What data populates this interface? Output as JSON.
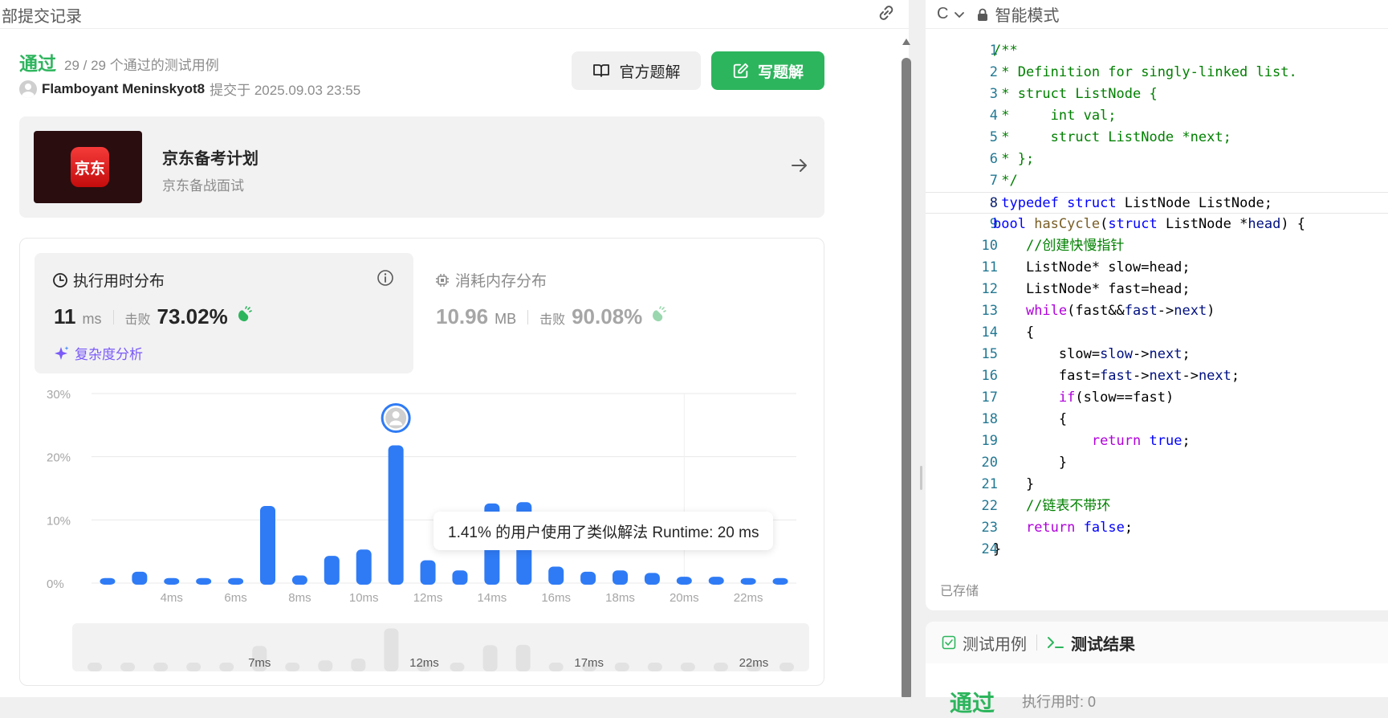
{
  "header": {
    "title": "部提交记录"
  },
  "submission": {
    "status": "通过",
    "testcases": "29 / 29 个通过的测试用例",
    "author": "Flamboyant Meninskyot8",
    "submitted_at": "提交于 2025.09.03 23:55"
  },
  "buttons": {
    "official_solution": "官方题解",
    "write_solution": "写题解"
  },
  "promo": {
    "logo_text": "京东",
    "title": "京东备考计划",
    "subtitle": "京东备战面试"
  },
  "runtime": {
    "title": "执行用时分布",
    "value": "11",
    "unit": "ms",
    "beat_label": "击败",
    "beat": "73.02%",
    "complexity": "复杂度分析"
  },
  "memory": {
    "title": "消耗内存分布",
    "value": "10.96",
    "unit": "MB",
    "beat_label": "击败",
    "beat": "90.08%"
  },
  "chart_data": {
    "type": "bar",
    "ytick_labels": [
      "30%",
      "20%",
      "10%",
      "0%"
    ],
    "ylim": [
      0,
      30
    ],
    "x": [
      2,
      3,
      4,
      5,
      6,
      7,
      8,
      9,
      10,
      11,
      12,
      13,
      14,
      15,
      16,
      17,
      18,
      19,
      20,
      21,
      22,
      23
    ],
    "values": [
      0.8,
      1.8,
      0.8,
      0.8,
      0.8,
      12.2,
      1.2,
      4.3,
      5.3,
      21.8,
      3.6,
      2.0,
      12.6,
      12.8,
      2.6,
      1.8,
      2.0,
      1.6,
      1.0,
      1.0,
      0.8,
      0.8
    ],
    "xtick_labels": [
      {
        "x": 4,
        "label": "4ms"
      },
      {
        "x": 6,
        "label": "6ms"
      },
      {
        "x": 8,
        "label": "8ms"
      },
      {
        "x": 10,
        "label": "10ms"
      },
      {
        "x": 12,
        "label": "12ms"
      },
      {
        "x": 14,
        "label": "14ms"
      },
      {
        "x": 16,
        "label": "16ms"
      },
      {
        "x": 18,
        "label": "18ms"
      },
      {
        "x": 20,
        "label": "20ms"
      },
      {
        "x": 22,
        "label": "22ms"
      }
    ],
    "highlight_x": 11,
    "bar_color": "#2f7bf5",
    "grid": true,
    "overview_labels": [
      {
        "x": 7,
        "label": "7ms"
      },
      {
        "x": 12,
        "label": "12ms"
      },
      {
        "x": 17,
        "label": "17ms"
      },
      {
        "x": 22,
        "label": "22ms"
      }
    ]
  },
  "tooltip": {
    "text": "1.41% 的用户使用了类似解法 Runtime: 20 ms"
  },
  "editor": {
    "language": "C",
    "mode": "智能模式",
    "saved": "已存储",
    "active_line": 8,
    "lines": [
      [
        [
          "c-com",
          "/**"
        ]
      ],
      [
        [
          "c-com",
          " * Definition for singly-linked list."
        ]
      ],
      [
        [
          "c-com",
          " * struct ListNode {"
        ]
      ],
      [
        [
          "c-com",
          " *     int val;"
        ]
      ],
      [
        [
          "c-com",
          " *     struct ListNode *next;"
        ]
      ],
      [
        [
          "c-com",
          " * };"
        ]
      ],
      [
        [
          "c-com",
          " */"
        ]
      ],
      [
        [
          "c-kw",
          " typedef"
        ],
        [
          "c-txt",
          " "
        ],
        [
          "c-kw",
          "struct"
        ],
        [
          "c-txt",
          " ListNode ListNode;"
        ]
      ],
      [
        [
          "c-kw",
          "bool"
        ],
        [
          "c-txt",
          " "
        ],
        [
          "c-fn",
          "hasCycle"
        ],
        [
          "c-txt",
          "("
        ],
        [
          "c-kw",
          "struct"
        ],
        [
          "c-txt",
          " ListNode *"
        ],
        [
          "c-var",
          "head"
        ],
        [
          "c-txt",
          ") {"
        ]
      ],
      [
        [
          "c-txt",
          "    "
        ],
        [
          "c-com",
          "//创建快慢指针"
        ]
      ],
      [
        [
          "c-txt",
          "    ListNode* slow=head;"
        ]
      ],
      [
        [
          "c-txt",
          "    ListNode* fast=head;"
        ]
      ],
      [
        [
          "c-txt",
          "    "
        ],
        [
          "c-ctl",
          "while"
        ],
        [
          "c-txt",
          "(fast&&"
        ],
        [
          "c-var",
          "fast"
        ],
        [
          "c-txt",
          "->"
        ],
        [
          "c-var",
          "next"
        ],
        [
          "c-txt",
          ")"
        ]
      ],
      [
        [
          "c-txt",
          "    {"
        ]
      ],
      [
        [
          "c-txt",
          "        slow="
        ],
        [
          "c-var",
          "slow"
        ],
        [
          "c-txt",
          "->"
        ],
        [
          "c-var",
          "next"
        ],
        [
          "c-txt",
          ";"
        ]
      ],
      [
        [
          "c-txt",
          "        fast="
        ],
        [
          "c-var",
          "fast"
        ],
        [
          "c-txt",
          "->"
        ],
        [
          "c-var",
          "next"
        ],
        [
          "c-txt",
          "->"
        ],
        [
          "c-var",
          "next"
        ],
        [
          "c-txt",
          ";"
        ]
      ],
      [
        [
          "c-txt",
          "        "
        ],
        [
          "c-ctl",
          "if"
        ],
        [
          "c-txt",
          "(slow==fast)"
        ]
      ],
      [
        [
          "c-txt",
          "        {"
        ]
      ],
      [
        [
          "c-txt",
          "            "
        ],
        [
          "c-ctl",
          "return"
        ],
        [
          "c-txt",
          " "
        ],
        [
          "c-kw",
          "true"
        ],
        [
          "c-txt",
          ";"
        ]
      ],
      [
        [
          "c-txt",
          "        }"
        ]
      ],
      [
        [
          "c-txt",
          "    }"
        ]
      ],
      [
        [
          "c-txt",
          "    "
        ],
        [
          "c-com",
          "//链表不带环"
        ]
      ],
      [
        [
          "c-txt",
          "    "
        ],
        [
          "c-ctl",
          "return"
        ],
        [
          "c-txt",
          " "
        ],
        [
          "c-kw",
          "false"
        ],
        [
          "c-txt",
          ";"
        ]
      ],
      [
        [
          "c-txt",
          "}"
        ]
      ]
    ]
  },
  "result_panel": {
    "tab_testcase": "测试用例",
    "tab_result": "测试结果",
    "status": "通过",
    "runtime_label": "执行用时: 0"
  }
}
